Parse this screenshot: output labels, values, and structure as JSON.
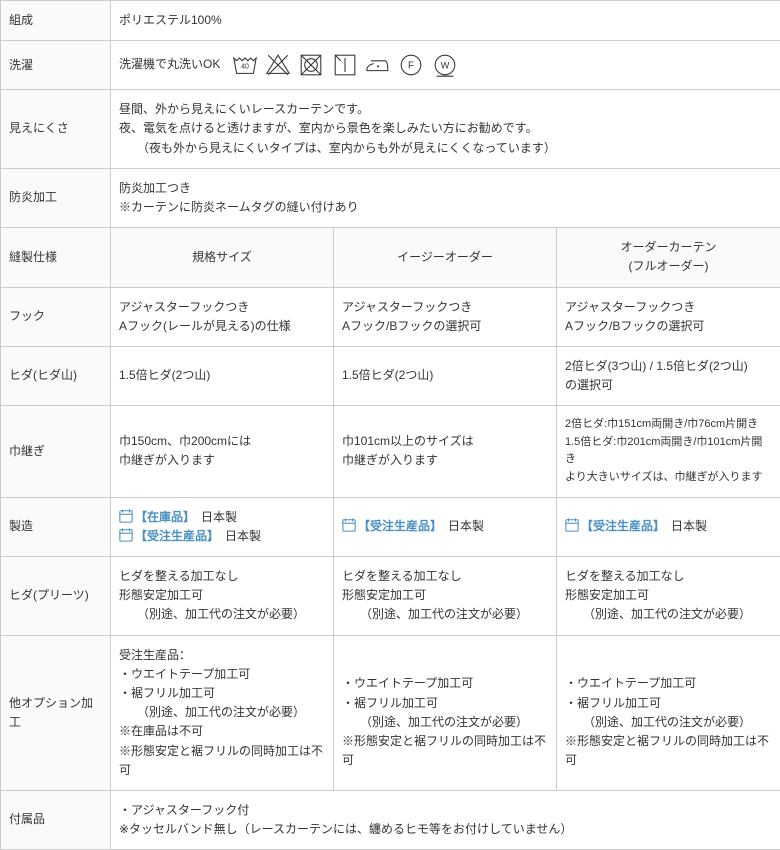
{
  "rows": {
    "composition": {
      "label": "組成",
      "value": "ポリエステル100%"
    },
    "wash": {
      "label": "洗濯",
      "value": "洗濯機で丸洗いOK"
    },
    "visibility": {
      "label": "見えにくさ",
      "line1": "昼間、外から見えにくいレースカーテンです。",
      "line2": "夜、電気を点けると透けますが、室内から景色を楽しみたい方にお勧めです。",
      "line3": "（夜も外から見えにくいタイプは、室内からも外が見えにくくなっています）"
    },
    "fireproof": {
      "label": "防炎加工",
      "line1": "防炎加工つき",
      "line2": "※カーテンに防炎ネームタグの縫い付けあり"
    },
    "spec_header": {
      "label": "縫製仕様",
      "col1": "規格サイズ",
      "col2": "イージーオーダー",
      "col3a": "オーダーカーテン",
      "col3b": "(フルオーダー)"
    },
    "hook": {
      "label": "フック",
      "c1a": "アジャスターフックつき",
      "c1b": "Aフック(レールが見える)の仕様",
      "c2a": "アジャスターフックつき",
      "c2b": "Aフック/Bフックの選択可",
      "c3a": "アジャスターフックつき",
      "c3b": "Aフック/Bフックの選択可"
    },
    "pleat_mountain": {
      "label": "ヒダ(ヒダ山)",
      "c1": "1.5倍ヒダ(2つ山)",
      "c2": "1.5倍ヒダ(2つ山)",
      "c3a": "2倍ヒダ(3つ山) / 1.5倍ヒダ(2つ山)",
      "c3b": "の選択可"
    },
    "seam": {
      "label": "巾継ぎ",
      "c1a": "巾150cm、巾200cmには",
      "c1b": "巾継ぎが入ります",
      "c2a": "巾101cm以上のサイズは",
      "c2b": "巾継ぎが入ります",
      "c3a": "2倍ヒダ:巾151cm両開き/巾76cm片開き",
      "c3b": "1.5倍ヒダ:巾201cm両開き/巾101cm片開き",
      "c3c": "より大きいサイズは、巾継ぎが入ります"
    },
    "manufacture": {
      "label": "製造",
      "stock_tag": "【在庫品】",
      "made": "日本製",
      "order_tag": "【受注生産品】"
    },
    "pleat": {
      "label": "ヒダ(プリーツ)",
      "l1": "ヒダを整える加工なし",
      "l2": "形態安定加工可",
      "l3": "（別途、加工代の注文が必要）"
    },
    "option": {
      "label": "他オプション加工",
      "c1_l1": "受注生産品：",
      "weight": "・ウエイトテープ加工可",
      "frill": "・裾フリル加工可",
      "extra": "（別途、加工代の注文が必要）",
      "c1_note1": "※在庫品は不可",
      "note_combined": "※形態安定と裾フリルの同時加工は不可"
    },
    "accessory": {
      "label": "付属品",
      "line1": "・アジャスターフック付",
      "line2": "※タッセルバンド無し（レースカーテンには、纏めるヒモ等をお付けしていません）"
    }
  }
}
